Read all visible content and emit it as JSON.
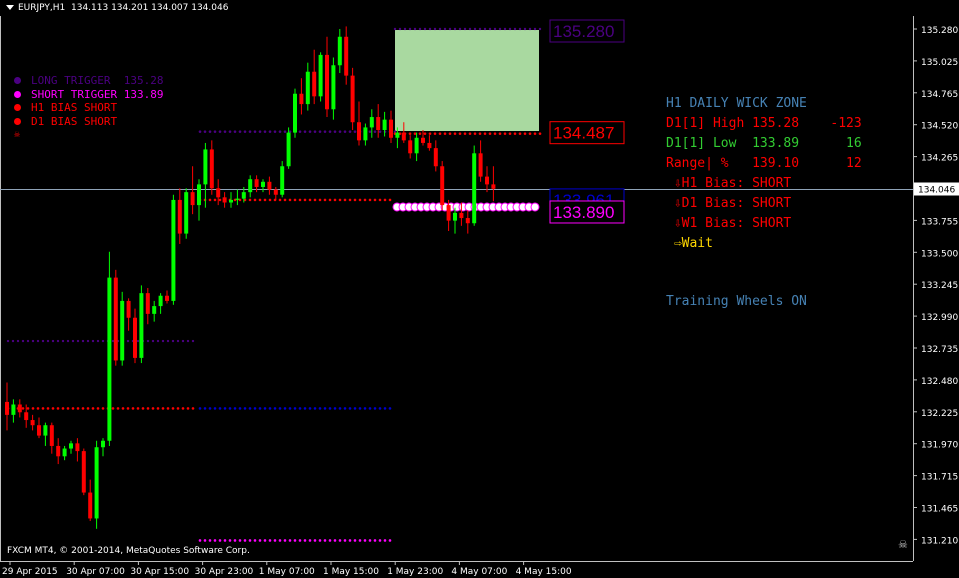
{
  "header": {
    "symbol_timeframe": "EURJPY,H1",
    "ohlc": "134.113 134.201 134.007 134.046"
  },
  "legend": [
    {
      "label": "LONG TRIGGER  135.28",
      "color": "#4b0082"
    },
    {
      "label": "SHORT TRIGGER 133.89",
      "color": "#ff00ff"
    },
    {
      "label": "H1 BIAS SHORT",
      "color": "#ff0000"
    },
    {
      "label": "D1 BIAS SHORT",
      "color": "#ff0000"
    }
  ],
  "panel": {
    "title": "H1 DAILY WICK ZONE",
    "high": {
      "label": "D1[1] High",
      "value": "135.28",
      "extra": "-123"
    },
    "low": {
      "label": "D1[1] Low",
      "value": "133.89",
      "extra": "16"
    },
    "range": {
      "label": "Range| %",
      "value": "139.10",
      "extra": "12"
    },
    "biases": [
      "H1 Bias: SHORT",
      "D1 Bias: SHORT",
      "W1 Bias: SHORT"
    ],
    "wait": "Wait",
    "training": "Training Wheels ON"
  },
  "price_labels": {
    "long": "135.280",
    "mid": "134.487",
    "short": "133.890",
    "hidden": "133.961",
    "current": "134.046"
  },
  "y_axis": [
    "135.280",
    "135.025",
    "134.765",
    "134.520",
    "134.265",
    "134.010",
    "133.755",
    "133.500",
    "133.245",
    "132.990",
    "132.735",
    "132.480",
    "132.225",
    "131.970",
    "131.715",
    "131.465",
    "131.210"
  ],
  "x_axis": [
    "29 Apr 2015",
    "30 Apr 07:00",
    "30 Apr 15:00",
    "30 Apr 23:00",
    "1 May 07:00",
    "1 May 15:00",
    "1 May 23:00",
    "4 May 07:00",
    "4 May 15:00"
  ],
  "footer": {
    "copyright": "FXCM MT4, © 2001-2014, MetaQuotes Software Corp."
  },
  "colors": {
    "bull": "#00ff00",
    "bear": "#ff0000",
    "zone": "#a9d9a0",
    "grid": "#c0c0c0"
  },
  "chart_data": {
    "type": "candlestick",
    "ylim": [
      131.21,
      135.32
    ],
    "candles": [
      [
        132.4,
        132.55,
        132.18,
        132.3
      ],
      [
        132.3,
        132.42,
        132.24,
        132.38
      ],
      [
        132.38,
        132.42,
        132.28,
        132.32
      ],
      [
        132.32,
        132.38,
        132.2,
        132.26
      ],
      [
        132.26,
        132.3,
        132.18,
        132.22
      ],
      [
        132.22,
        132.28,
        132.12,
        132.14
      ],
      [
        132.14,
        132.24,
        132.06,
        132.22
      ],
      [
        132.22,
        132.24,
        132.0,
        132.06
      ],
      [
        132.06,
        132.12,
        131.92,
        131.98
      ],
      [
        131.98,
        132.06,
        131.95,
        132.04
      ],
      [
        132.04,
        132.1,
        132.0,
        132.08
      ],
      [
        132.08,
        132.12,
        131.94,
        132.02
      ],
      [
        132.02,
        132.04,
        131.68,
        131.7
      ],
      [
        131.7,
        131.8,
        131.48,
        131.5
      ],
      [
        131.5,
        132.1,
        131.42,
        132.05
      ],
      [
        132.05,
        132.12,
        131.98,
        132.1
      ],
      [
        132.1,
        133.56,
        132.06,
        133.36
      ],
      [
        133.36,
        133.42,
        132.68,
        132.72
      ],
      [
        132.72,
        133.25,
        132.68,
        133.18
      ],
      [
        133.18,
        133.2,
        132.95,
        133.05
      ],
      [
        133.05,
        133.12,
        132.7,
        132.74
      ],
      [
        132.74,
        133.3,
        132.7,
        133.24
      ],
      [
        133.24,
        133.28,
        133.0,
        133.08
      ],
      [
        133.08,
        133.18,
        133.02,
        133.14
      ],
      [
        133.14,
        133.24,
        133.08,
        133.22
      ],
      [
        133.22,
        133.26,
        133.16,
        133.18
      ],
      [
        133.18,
        134.0,
        133.15,
        133.96
      ],
      [
        133.96,
        134.05,
        133.62,
        133.7
      ],
      [
        133.7,
        134.05,
        133.66,
        134.02
      ],
      [
        134.02,
        134.22,
        133.85,
        133.92
      ],
      [
        133.92,
        134.12,
        133.8,
        134.08
      ],
      [
        134.08,
        134.4,
        133.9,
        134.35
      ],
      [
        134.35,
        134.42,
        134.0,
        134.05
      ],
      [
        134.05,
        134.12,
        133.92,
        133.98
      ],
      [
        133.98,
        134.02,
        133.9,
        133.94
      ],
      [
        133.94,
        134.02,
        133.9,
        133.96
      ],
      [
        133.96,
        134.04,
        133.92,
        133.97
      ],
      [
        133.97,
        134.06,
        133.94,
        134.02
      ],
      [
        134.02,
        134.15,
        133.98,
        134.12
      ],
      [
        134.12,
        134.15,
        134.02,
        134.06
      ],
      [
        134.06,
        134.12,
        134.02,
        134.1
      ],
      [
        134.1,
        134.14,
        134.0,
        134.04
      ],
      [
        134.04,
        134.06,
        133.96,
        134.0
      ],
      [
        134.0,
        134.26,
        133.98,
        134.22
      ],
      [
        134.22,
        134.52,
        134.2,
        134.48
      ],
      [
        134.48,
        134.82,
        134.44,
        134.78
      ],
      [
        134.78,
        134.9,
        134.62,
        134.7
      ],
      [
        134.7,
        135.02,
        134.65,
        134.95
      ],
      [
        134.95,
        135.12,
        134.7,
        134.76
      ],
      [
        134.76,
        135.1,
        134.72,
        135.08
      ],
      [
        135.08,
        135.22,
        134.6,
        134.66
      ],
      [
        134.66,
        135.06,
        134.58,
        135.0
      ],
      [
        135.0,
        135.28,
        134.94,
        135.22
      ],
      [
        135.22,
        135.3,
        134.85,
        134.92
      ],
      [
        134.92,
        134.98,
        134.5,
        134.56
      ],
      [
        134.56,
        134.72,
        134.38,
        134.42
      ],
      [
        134.42,
        134.55,
        134.38,
        134.52
      ],
      [
        134.52,
        134.66,
        134.44,
        134.6
      ],
      [
        134.6,
        134.7,
        134.44,
        134.5
      ],
      [
        134.5,
        134.64,
        134.45,
        134.58
      ],
      [
        134.58,
        134.65,
        134.4,
        134.44
      ],
      [
        134.44,
        134.52,
        134.36,
        134.48
      ],
      [
        134.48,
        134.56,
        134.4,
        134.42
      ],
      [
        134.42,
        134.46,
        134.28,
        134.32
      ],
      [
        134.32,
        134.48,
        134.26,
        134.44
      ],
      [
        134.44,
        134.5,
        134.38,
        134.4
      ],
      [
        134.4,
        134.46,
        134.34,
        134.36
      ],
      [
        134.36,
        134.42,
        134.18,
        134.22
      ],
      [
        134.22,
        134.26,
        133.88,
        133.92
      ],
      [
        133.92,
        133.96,
        133.72,
        133.8
      ],
      [
        133.8,
        133.9,
        133.7,
        133.86
      ],
      [
        133.86,
        133.94,
        133.76,
        133.82
      ],
      [
        133.82,
        133.88,
        133.7,
        133.78
      ],
      [
        133.78,
        134.38,
        133.76,
        134.32
      ],
      [
        134.32,
        134.42,
        134.1,
        134.14
      ],
      [
        134.14,
        134.22,
        134.02,
        134.08
      ],
      [
        134.08,
        134.22,
        133.95,
        134.046
      ]
    ],
    "levels": [
      {
        "name": "LONG TRIGGER",
        "value": 135.28,
        "color": "#4b0082"
      },
      {
        "name": "SHORT TRIGGER",
        "value": 133.89,
        "color": "#ff00ff"
      },
      {
        "name": "D1 High",
        "value": 135.28
      },
      {
        "name": "D1 Low",
        "value": 133.89
      }
    ]
  }
}
